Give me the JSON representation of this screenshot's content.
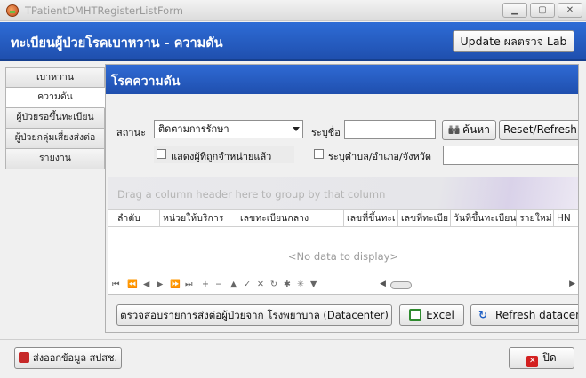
{
  "window": {
    "title": "TPatientDMHTRegisterListForm"
  },
  "header": {
    "title": "ทะเบียนผู้ป่วยโรคเบาหวาน - ความดัน",
    "update_button": "Update ผลตรวจ Lab"
  },
  "sidebar": {
    "items": [
      {
        "label": "เบาหวาน"
      },
      {
        "label": "ความดัน"
      },
      {
        "label": "ผู้ป่วยรอขึ้นทะเบียน"
      },
      {
        "label": "ผู้ป่วยกลุ่มเสี่ยงส่งต่อ"
      },
      {
        "label": "รายงาน"
      }
    ]
  },
  "panel": {
    "title": "โรคความดัน",
    "status_label": "สถานะ",
    "status_value": "ติดตามการรักษา",
    "name_label": "ระบุชื่อ",
    "search_button": "ค้นหา",
    "reset_button": "Reset/Refresh",
    "show_discharged_label": "แสดงผู้ที่ถูกจำหน่ายแล้ว",
    "area_label": "ระบุตำบล/อำเภอ/จังหวัด"
  },
  "grid": {
    "group_hint": "Drag a column header here to group by that column",
    "columns": [
      "ลำดับ",
      "หน่วยให้บริการ",
      "เลขทะเบียนกลาง",
      "เลขที่ขึ้นทะเ",
      "เลขที่ทะเบีย",
      "วันที่ขึ้นทะเบียน",
      "รายใหม่",
      "HN"
    ],
    "empty_text": "<No data to display>",
    "nav_glyphs": [
      "⏮",
      "⏪",
      "◀",
      "▶",
      "⏩",
      "⏭",
      "+",
      "−",
      "▲",
      "✓",
      "✕",
      "↻",
      "✱",
      "✳",
      "▼"
    ]
  },
  "panel_actions": {
    "datacenter_button": "ตรวจสอบรายการส่งต่อผู้ป่วยจาก โรงพยาบาล (Datacenter)",
    "excel_button": "Excel",
    "refresh_button": "Refresh datacenter"
  },
  "footer": {
    "export_button": "ส่งออกข้อมูล สปสช.",
    "dash": "—",
    "close_button": "ปิด"
  }
}
